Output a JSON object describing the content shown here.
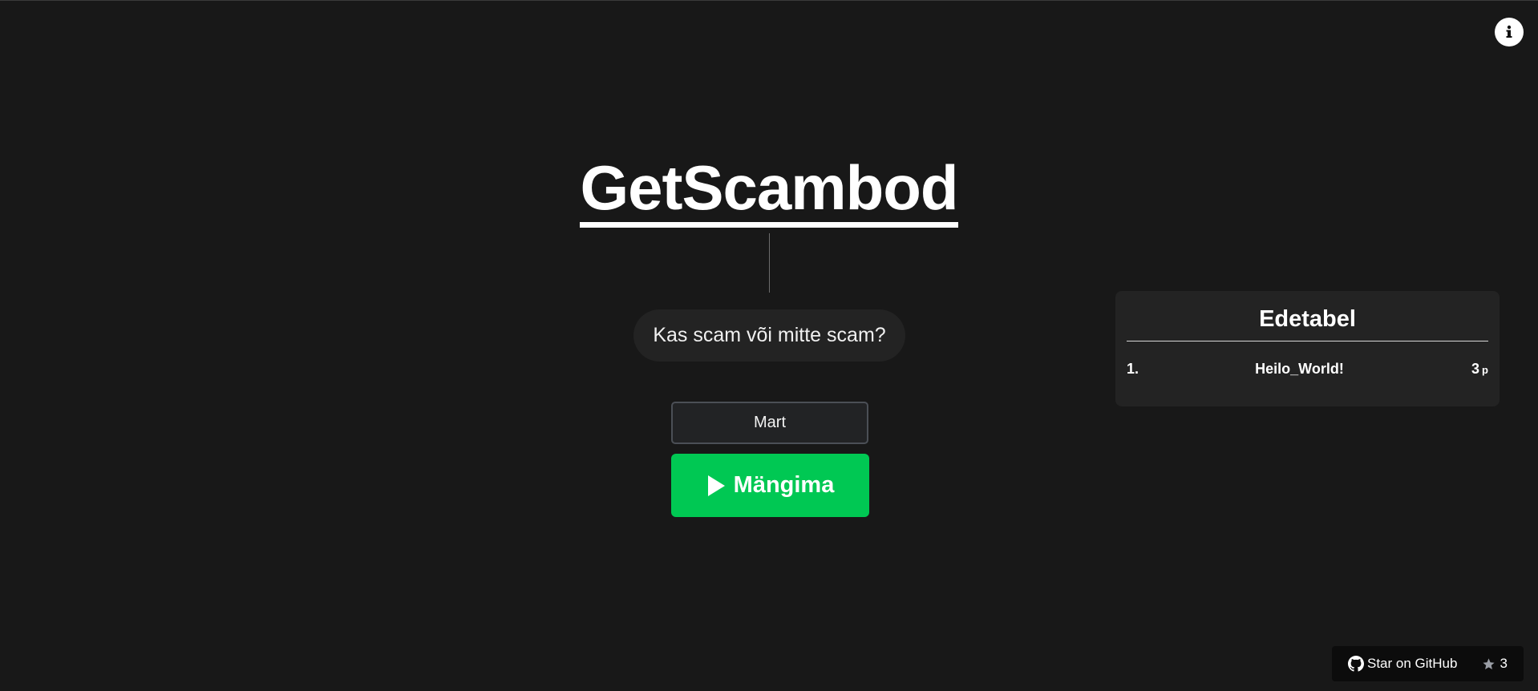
{
  "header": {
    "info_icon": "info-icon"
  },
  "hero": {
    "title": "GetScambod",
    "tagline": "Kas scam või mitte scam?"
  },
  "form": {
    "name_value": "Mart",
    "play_label": "Mängima",
    "play_icon": "play-icon"
  },
  "leaderboard": {
    "title": "Edetabel",
    "entries": [
      {
        "rank": "1.",
        "name": "Heilo_World!",
        "score": "3",
        "unit": "p"
      }
    ]
  },
  "github": {
    "label": "Star on GitHub",
    "stars": "3",
    "icons": [
      "github-icon",
      "star-icon"
    ]
  },
  "colors": {
    "background": "#181818",
    "accent": "#00c853",
    "panel": "#232323"
  }
}
